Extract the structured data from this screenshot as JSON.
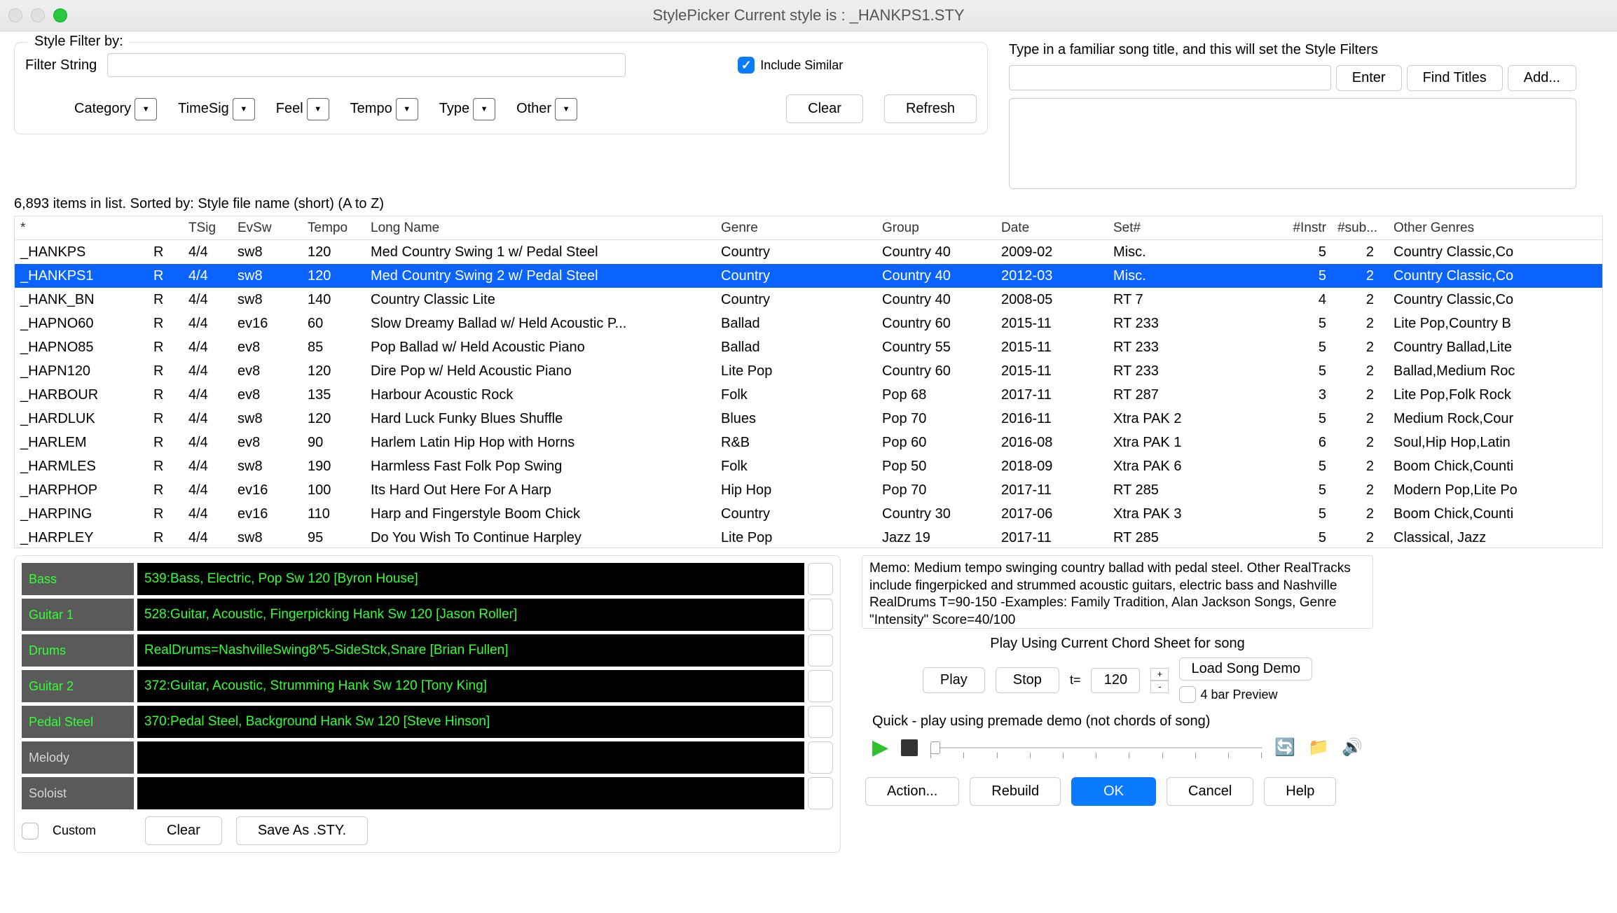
{
  "window": {
    "title": "StylePicker    Current style is : _HANKPS1.STY"
  },
  "filter": {
    "legend": "Style Filter by:",
    "filter_string_label": "Filter String",
    "include_similar_label": "Include Similar",
    "categories": [
      "Category",
      "TimeSig",
      "Feel",
      "Tempo",
      "Type",
      "Other"
    ],
    "clear": "Clear",
    "refresh": "Refresh"
  },
  "song_panel": {
    "hint": "Type in a familiar song title, and this will set the Style Filters",
    "enter": "Enter",
    "find_titles": "Find Titles",
    "add": "Add..."
  },
  "list_status": "6,893 items in list. Sorted by: Style file name (short)  (A to Z)",
  "columns": [
    "*",
    "",
    "TSig",
    "EvSw",
    "Tempo",
    "Long Name",
    "Genre",
    "Group",
    "Date",
    "Set#",
    "#Instr",
    "#sub...",
    "Other Genres"
  ],
  "rows": [
    {
      "name": "_HANKPS",
      "r": "R",
      "tsig": "4/4",
      "evsw": "sw8",
      "tempo": "120",
      "long": "Med Country Swing 1 w/ Pedal Steel",
      "genre": "Country",
      "group": "Country 40",
      "date": "2009-02",
      "set": "Misc.",
      "instr": "5",
      "sub": "2",
      "other": "Country Classic,Co",
      "sel": false
    },
    {
      "name": "_HANKPS1",
      "r": "R",
      "tsig": "4/4",
      "evsw": "sw8",
      "tempo": "120",
      "long": "Med Country Swing 2 w/ Pedal Steel",
      "genre": "Country",
      "group": "Country 40",
      "date": "2012-03",
      "set": "Misc.",
      "instr": "5",
      "sub": "2",
      "other": "Country Classic,Co",
      "sel": true
    },
    {
      "name": "_HANK_BN",
      "r": "R",
      "tsig": "4/4",
      "evsw": "sw8",
      "tempo": "140",
      "long": "Country Classic Lite",
      "genre": "Country",
      "group": "Country 40",
      "date": "2008-05",
      "set": "RT 7",
      "instr": "4",
      "sub": "2",
      "other": "Country Classic,Co",
      "sel": false
    },
    {
      "name": "_HAPNO60",
      "r": "R",
      "tsig": "4/4",
      "evsw": "ev16",
      "tempo": "60",
      "long": "Slow Dreamy Ballad w/ Held Acoustic P...",
      "genre": "Ballad",
      "group": "Country 60",
      "date": "2015-11",
      "set": "RT 233",
      "instr": "5",
      "sub": "2",
      "other": "Lite Pop,Country B",
      "sel": false
    },
    {
      "name": "_HAPNO85",
      "r": "R",
      "tsig": "4/4",
      "evsw": "ev8",
      "tempo": "85",
      "long": "Pop Ballad w/ Held Acoustic Piano",
      "genre": "Ballad",
      "group": "Country 55",
      "date": "2015-11",
      "set": "RT 233",
      "instr": "5",
      "sub": "2",
      "other": "Country Ballad,Lite",
      "sel": false
    },
    {
      "name": "_HAPN120",
      "r": "R",
      "tsig": "4/4",
      "evsw": "ev8",
      "tempo": "120",
      "long": "Dire Pop w/ Held Acoustic Piano",
      "genre": "Lite Pop",
      "group": "Country 60",
      "date": "2015-11",
      "set": "RT 233",
      "instr": "5",
      "sub": "2",
      "other": "Ballad,Medium Roc",
      "sel": false
    },
    {
      "name": "_HARBOUR",
      "r": "R",
      "tsig": "4/4",
      "evsw": "ev8",
      "tempo": "135",
      "long": "Harbour Acoustic Rock",
      "genre": "Folk",
      "group": "Pop 68",
      "date": "2017-11",
      "set": "RT 287",
      "instr": "3",
      "sub": "2",
      "other": "Lite Pop,Folk Rock",
      "sel": false
    },
    {
      "name": "_HARDLUK",
      "r": "R",
      "tsig": "4/4",
      "evsw": "sw8",
      "tempo": "120",
      "long": "Hard Luck Funky Blues Shuffle",
      "genre": "Blues",
      "group": "Pop 70",
      "date": "2016-11",
      "set": "Xtra PAK 2",
      "instr": "5",
      "sub": "2",
      "other": "Medium Rock,Cour",
      "sel": false
    },
    {
      "name": "_HARLEM",
      "r": "R",
      "tsig": "4/4",
      "evsw": "ev8",
      "tempo": "90",
      "long": "Harlem Latin Hip Hop with Horns",
      "genre": "R&B",
      "group": "Pop 60",
      "date": "2016-08",
      "set": "Xtra PAK 1",
      "instr": "6",
      "sub": "2",
      "other": "Soul,Hip Hop,Latin",
      "sel": false
    },
    {
      "name": "_HARMLES",
      "r": "R",
      "tsig": "4/4",
      "evsw": "sw8",
      "tempo": "190",
      "long": "Harmless Fast Folk Pop Swing",
      "genre": "Folk",
      "group": "Pop 50",
      "date": "2018-09",
      "set": "Xtra PAK 6",
      "instr": "5",
      "sub": "2",
      "other": "Boom Chick,Counti",
      "sel": false
    },
    {
      "name": "_HARPHOP",
      "r": "R",
      "tsig": "4/4",
      "evsw": "ev16",
      "tempo": "100",
      "long": "Its Hard Out Here For A Harp",
      "genre": "Hip Hop",
      "group": "Pop 70",
      "date": "2017-11",
      "set": "RT 285",
      "instr": "5",
      "sub": "2",
      "other": "Modern Pop,Lite Po",
      "sel": false
    },
    {
      "name": "_HARPING",
      "r": "R",
      "tsig": "4/4",
      "evsw": "ev16",
      "tempo": "110",
      "long": "Harp and Fingerstyle Boom Chick",
      "genre": "Country",
      "group": "Country 30",
      "date": "2017-06",
      "set": "Xtra PAK 3",
      "instr": "5",
      "sub": "2",
      "other": "Boom Chick,Counti",
      "sel": false
    },
    {
      "name": "_HARPLEY",
      "r": "R",
      "tsig": "4/4",
      "evsw": "sw8",
      "tempo": "95",
      "long": "Do You Wish To Continue Harpley",
      "genre": "Lite Pop",
      "group": "Jazz 19",
      "date": "2017-11",
      "set": "RT 285",
      "instr": "5",
      "sub": "2",
      "other": "Classical, Jazz",
      "sel": false
    }
  ],
  "tracks": [
    {
      "label": "Bass",
      "dim": false,
      "value": "539:Bass, Electric, Pop Sw 120 [Byron House]"
    },
    {
      "label": "Guitar 1",
      "dim": false,
      "value": "528:Guitar, Acoustic, Fingerpicking Hank Sw 120 [Jason Roller]"
    },
    {
      "label": "Drums",
      "dim": false,
      "value": "RealDrums=NashvilleSwing8^5-SideStck,Snare [Brian Fullen]"
    },
    {
      "label": "Guitar 2",
      "dim": false,
      "value": "372:Guitar, Acoustic, Strumming Hank Sw 120 [Tony King]"
    },
    {
      "label": "Pedal Steel",
      "dim": false,
      "value": "370:Pedal Steel, Background Hank Sw 120 [Steve Hinson]"
    },
    {
      "label": "Melody",
      "dim": true,
      "value": ""
    },
    {
      "label": "Soloist",
      "dim": true,
      "value": ""
    }
  ],
  "tracks_buttons": {
    "custom": "Custom",
    "clear": "Clear",
    "save_as": "Save As .STY."
  },
  "memo": "Memo: Medium tempo swinging country ballad with pedal steel. Other RealTracks include fingerpicked and strummed acoustic guitars, electric bass and Nashville RealDrums T=90-150 -Examples: Family Tradition, Alan Jackson Songs, Genre \"Intensity\" Score=40/100",
  "playback": {
    "label": "Play Using Current Chord Sheet for song",
    "play": "Play",
    "stop": "Stop",
    "t_label": "t=",
    "tempo": "120",
    "load_demo": "Load Song Demo",
    "four_bar": "4 bar Preview",
    "quick_label": "Quick - play using premade demo (not chords of song)"
  },
  "bottom_buttons": {
    "action": "Action...",
    "rebuild": "Rebuild",
    "ok": "OK",
    "cancel": "Cancel",
    "help": "Help"
  }
}
